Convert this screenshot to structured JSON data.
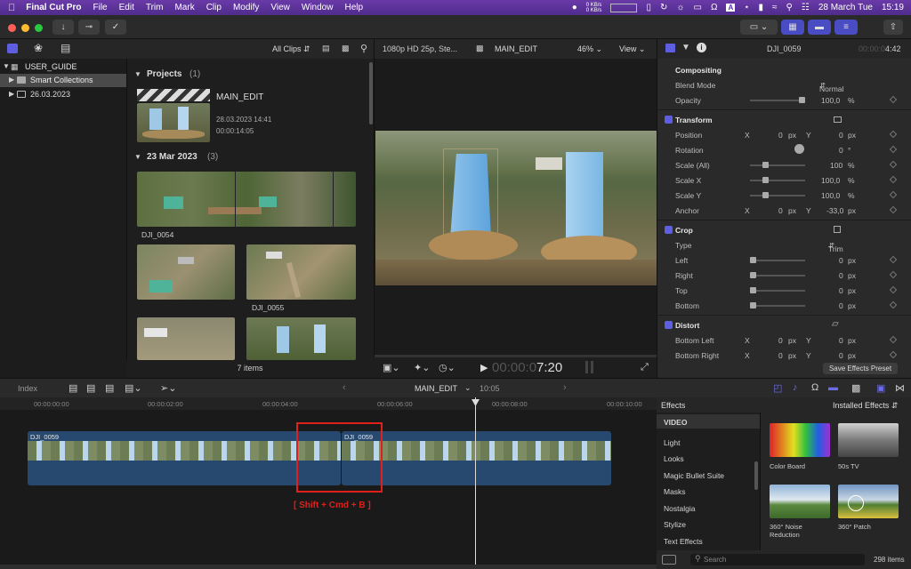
{
  "menubar": {
    "app": "Final Cut Pro",
    "items": [
      "File",
      "Edit",
      "Trim",
      "Mark",
      "Clip",
      "Modify",
      "View",
      "Window",
      "Help"
    ],
    "net_up": "0 KB/s",
    "net_down": "0 KB/s",
    "date": "28 March Tue",
    "time": "15:19"
  },
  "library": {
    "name": "USER_GUIDE",
    "items": [
      "Smart Collections",
      "26.03.2023"
    ]
  },
  "browser": {
    "filter": "All Clips",
    "projects_header": "Projects",
    "projects_count": "(1)",
    "project": {
      "name": "MAIN_EDIT",
      "date": "28.03.2023 14:41",
      "duration": "00:00:14:05"
    },
    "date_header": "23 Mar 2023",
    "date_count": "(3)",
    "clips": [
      "DJI_0054",
      "DJI_0055"
    ],
    "footer": "7 items"
  },
  "viewer": {
    "format": "1080p HD 25p, Ste...",
    "project": "MAIN_EDIT",
    "zoom": "46%",
    "view_label": "View",
    "timecode_dim": "00:00:0",
    "timecode": "7:20"
  },
  "inspector": {
    "clip": "DJI_0059",
    "duration_dim": "00:00:0",
    "duration": "4:42",
    "compositing": "Compositing",
    "blend_mode_label": "Blend Mode",
    "blend_mode": "Normal",
    "opacity_label": "Opacity",
    "opacity": "100,0",
    "pct": "%",
    "transform": "Transform",
    "position_label": "Position",
    "position_x": "0",
    "position_y": "0",
    "px": "px",
    "x": "X",
    "y": "Y",
    "rotation_label": "Rotation",
    "rotation": "0",
    "deg": "°",
    "scale_all_label": "Scale (All)",
    "scale_all": "100",
    "scale_x_label": "Scale X",
    "scale_x": "100,0",
    "scale_y_label": "Scale Y",
    "scale_y": "100,0",
    "anchor_label": "Anchor",
    "anchor_x": "0",
    "anchor_y": "-33,0",
    "crop": "Crop",
    "type_label": "Type",
    "type": "Trim",
    "left_label": "Left",
    "right_label": "Right",
    "top_label": "Top",
    "bottom_label": "Bottom",
    "crop_value": "0",
    "distort": "Distort",
    "bottom_left_label": "Bottom Left",
    "bottom_right_label": "Bottom Right",
    "save_preset": "Save Effects Preset"
  },
  "timeline": {
    "index": "Index",
    "project": "MAIN_EDIT",
    "duration": "10:05",
    "ruler": [
      "00:00:00:00",
      "00:00:02:00",
      "00:00:04:00",
      "00:00:06:00",
      "00:00:08:00",
      "00:00:10:00"
    ],
    "clip_a": "DJI_0059",
    "clip_b": "DJI_0059",
    "shortcut": "[ Shift + Cmd + B ]"
  },
  "effects": {
    "title": "Effects",
    "installed": "Installed Effects",
    "categories": [
      "VIDEO",
      "Light",
      "Looks",
      "Magic Bullet Suite",
      "Masks",
      "Nostalgia",
      "Stylize",
      "Text Effects"
    ],
    "items": [
      "Color Board",
      "50s TV",
      "360° Noise Reduction",
      "360° Patch"
    ],
    "search_placeholder": "Search",
    "count": "298 items"
  },
  "colors": {
    "accent": "#5d5fe0",
    "menubar": "#5b32a0",
    "annotation": "#e0201a",
    "clip": "#27496f"
  }
}
